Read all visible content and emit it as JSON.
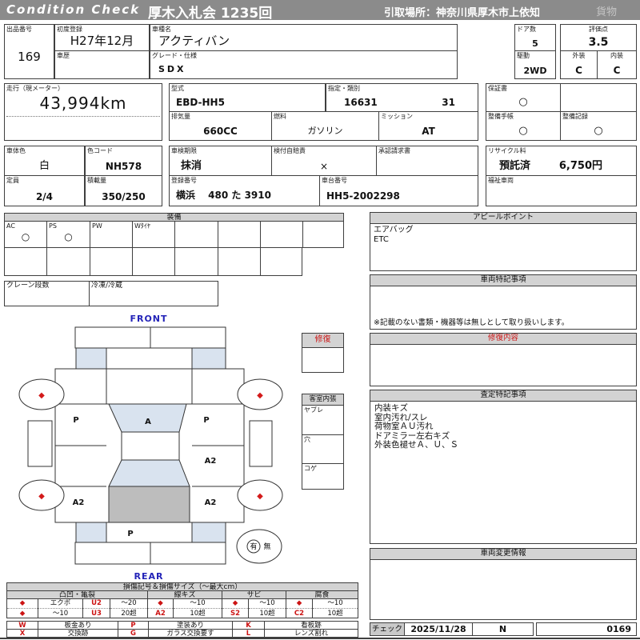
{
  "colors": {
    "bar_gray": "#8b8b8b",
    "header_gray": "#d3d3d3",
    "cell_gray": "#c9c9c9",
    "accent_red": "#cc1414",
    "light_blue": "#d9e3ef",
    "cargo_gray": "#bdbdbd",
    "label_blue": "#2323b8"
  },
  "header": {
    "brand": "Condition Check",
    "auction": "厚木入札会 1235回",
    "pickup": "引取場所：神奈川県厚木市上依知",
    "category": "貨物"
  },
  "info": {
    "lot_label": "出品番号",
    "lot_no": "169",
    "first_reg_label": "初度登録",
    "first_reg": "H27年12月",
    "history_label": "車歴",
    "history": "",
    "model_label": "車種名",
    "model": "アクティバン",
    "grade_label": "グレード・仕様",
    "grade": "SDX",
    "doors_label": "ドア数",
    "doors": "5",
    "drive_label": "駆動",
    "drive": "2WD",
    "score_label": "評価点",
    "score": "3.5",
    "exterior_label": "外装",
    "exterior_grade": "C",
    "interior_label": "内装",
    "interior_grade": "C",
    "mileage_label": "走行（現メーター）",
    "mileage": "43,994km",
    "type_label": "型式",
    "type": "EBD-HH5",
    "class_label": "指定・類別",
    "class_no": "16631",
    "class_sub": "31",
    "displacement_label": "排気量",
    "displacement": "660CC",
    "fuel_label": "燃料",
    "fuel": "ガソリン",
    "mission_label": "ミッション",
    "mission": "AT",
    "warranty_label": "保証書",
    "warranty": "○",
    "maint_book_label": "整備手帳",
    "maint_book": "○",
    "maint_record_label": "整備記録",
    "maint_record": "○",
    "body_color_label": "車体色",
    "body_color": "白",
    "color_code_label": "色コード",
    "color_code": "NH578",
    "inspection_label": "車検期限",
    "inspection": "抹消",
    "insurance_label": "検付自賠責",
    "insurance": "×",
    "approval_label": "承認請求書",
    "approval": "",
    "recycle_label": "リサイクル料",
    "recycle_status": "預託済",
    "recycle_fee": "6,750円",
    "capacity_label": "定員",
    "capacity": "2/4",
    "load_label": "積載量",
    "load": "350/250",
    "reg_no_label": "登録番号",
    "reg_no": "横浜　 480 た 3910",
    "chassis_label": "車台番号",
    "chassis": "HH5-2002298",
    "welfare_label": "福祉車両",
    "welfare": ""
  },
  "equipment": {
    "title": "装備",
    "cells": [
      {
        "label": "AC",
        "mark": "○"
      },
      {
        "label": "PS",
        "mark": "○"
      },
      {
        "label": "PW",
        "mark": ""
      },
      {
        "label": "Wﾀｲﾔ",
        "mark": ""
      },
      {
        "label": "",
        "mark": ""
      },
      {
        "label": "",
        "mark": ""
      },
      {
        "label": "",
        "mark": ""
      },
      {
        "label": "",
        "mark": ""
      }
    ],
    "crane_label": "クレーン段数",
    "freezer_label": "冷凍/冷蔵"
  },
  "appeal": {
    "title": "アピールポイント",
    "lines": [
      "エアバッグ",
      "ETC"
    ]
  },
  "vehicle_notes": {
    "title": "車両特記事項",
    "note": "※記載のない書類・機器等は無しとして取り扱いします。"
  },
  "repair_box": {
    "title": "修復"
  },
  "interior_box": {
    "title": "客室内張",
    "rows": [
      "ヤブレ",
      "穴",
      "コゲ"
    ]
  },
  "repair_content": {
    "title": "修復内容",
    "body": ""
  },
  "assessment": {
    "title": "査定特記事項",
    "lines": [
      "内装キズ",
      "室内汚れ/スレ",
      "荷物室ＡＵ汚れ",
      "ドアミラー左右キズ",
      "外装色褪せＡ、Ｕ、Ｓ"
    ]
  },
  "change_info": {
    "title": "車両変更情報",
    "body": ""
  },
  "check": {
    "label": "チェック",
    "date": "2025/11/28",
    "code": "N",
    "number": "0169"
  },
  "diagram": {
    "front": "FRONT",
    "rear": "REAR",
    "wheel_mark": "◆",
    "labels": {
      "lf_door": "P",
      "windshield": "A",
      "rf_door": "P",
      "right_mid": "A2",
      "left_rear": "A2",
      "right_rear": "A2",
      "rear_panel": "P"
    },
    "presence": {
      "yes": "有",
      "no": "無"
    }
  },
  "legend": {
    "title": "損傷記号＆損傷サイズ（～最大cm）",
    "groups": [
      {
        "name": "凸凹・亀裂",
        "rows": [
          [
            "◆",
            "エクボ",
            "U2",
            "～20"
          ],
          [
            "◆",
            "～10",
            "U3",
            "20超"
          ]
        ]
      },
      {
        "name": "線キズ",
        "rows": [
          [
            "◆",
            "～10"
          ],
          [
            "A2",
            "10超"
          ]
        ]
      },
      {
        "name": "サビ",
        "rows": [
          [
            "◆",
            "～10"
          ],
          [
            "S2",
            "10超"
          ]
        ]
      },
      {
        "name": "腐食",
        "rows": [
          [
            "◆",
            "～10"
          ],
          [
            "C2",
            "10超"
          ]
        ]
      }
    ],
    "codes": [
      {
        "code": "W",
        "desc": "板金あり"
      },
      {
        "code": "P",
        "desc": "塗装あり"
      },
      {
        "code": "K",
        "desc": "看板跡"
      },
      {
        "code": "X",
        "desc": "交換跡"
      },
      {
        "code": "G",
        "desc": "ガラス交換要す"
      },
      {
        "code": "L",
        "desc": "レンズ割れ"
      }
    ]
  }
}
